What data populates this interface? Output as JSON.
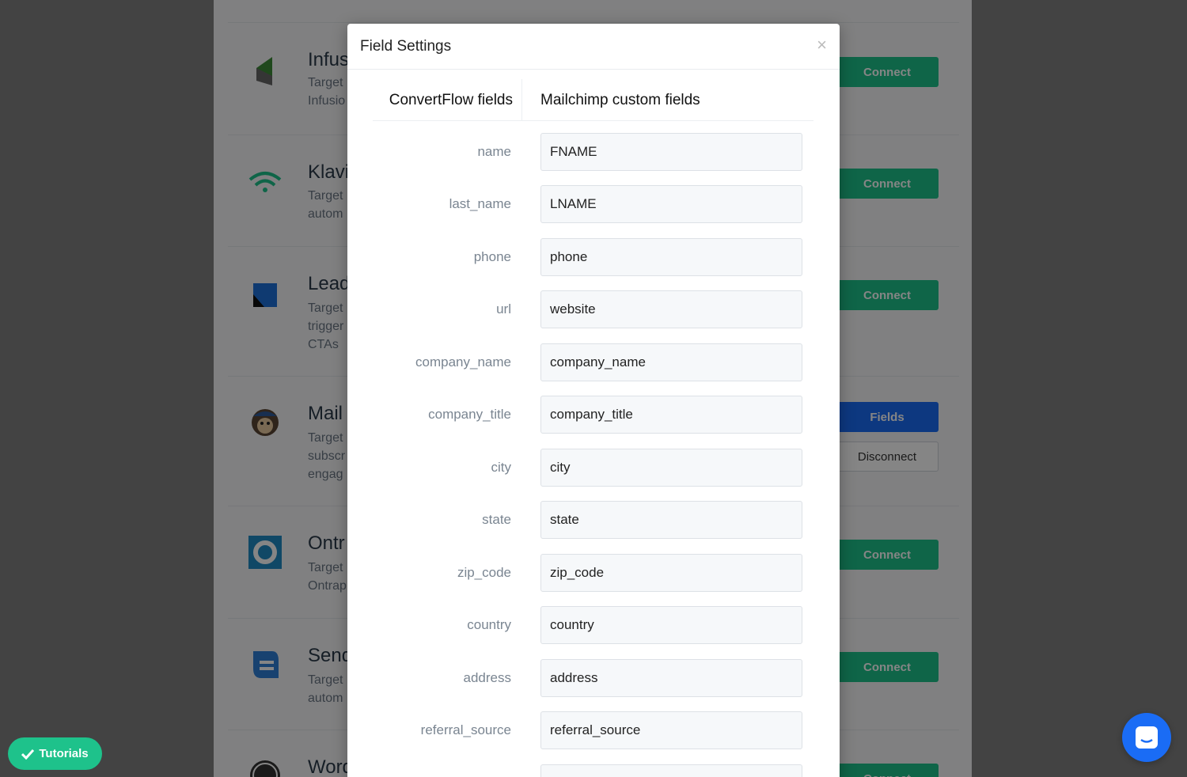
{
  "background": {
    "integrations": [
      {
        "title": "Infus",
        "desc": [
          "Target",
          "Infusio"
        ],
        "action": "Connect"
      },
      {
        "title": "Klavi",
        "desc": [
          "Target",
          "autom"
        ],
        "action": "Connect"
      },
      {
        "title": "Lead",
        "desc": [
          "Target",
          "trigger",
          "CTAs"
        ],
        "action": "Connect"
      },
      {
        "title": "Mail",
        "desc": [
          "Target",
          "subscr",
          "engag"
        ],
        "actions": [
          "Fields",
          "Disconnect"
        ]
      },
      {
        "title": "Ontr",
        "desc": [
          "Target",
          "Ontrap"
        ],
        "action": "Connect"
      },
      {
        "title": "Send",
        "desc": [
          "Target",
          "autom"
        ],
        "action": "Connect"
      },
      {
        "title": "Word",
        "desc": [],
        "action": "Connect"
      }
    ]
  },
  "modal": {
    "title": "Field Settings",
    "close": "×",
    "left_header": "ConvertFlow fields",
    "right_header": "Mailchimp custom fields",
    "fields": [
      {
        "label": "name",
        "value": "FNAME"
      },
      {
        "label": "last_name",
        "value": "LNAME"
      },
      {
        "label": "phone",
        "value": "phone"
      },
      {
        "label": "url",
        "value": "website"
      },
      {
        "label": "company_name",
        "value": "company_name"
      },
      {
        "label": "company_title",
        "value": "company_title"
      },
      {
        "label": "city",
        "value": "city"
      },
      {
        "label": "state",
        "value": "state"
      },
      {
        "label": "zip_code",
        "value": "zip_code"
      },
      {
        "label": "country",
        "value": "country"
      },
      {
        "label": "address",
        "value": "address"
      },
      {
        "label": "referral_source",
        "value": "referral_source"
      }
    ]
  },
  "tutorials": {
    "label": "Tutorials",
    "icon": "check-icon"
  },
  "chat": {
    "icon": "chat-icon"
  },
  "colors": {
    "green": "#1ec28b",
    "blue": "#1a6cf5"
  }
}
